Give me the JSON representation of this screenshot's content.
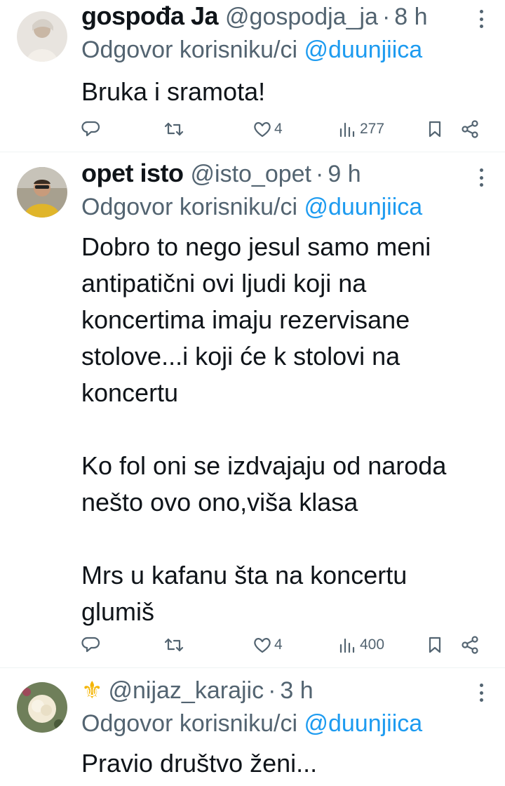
{
  "reply_prefix": "Odgovor korisniku/ci",
  "tweets": [
    {
      "name": "gospođa Ja",
      "handle": "@gospodja_ja",
      "separator": "·",
      "time": "8 h",
      "reply_to": "@duunjiica",
      "text": "Bruka i sramota!",
      "likes": "4",
      "views": "277"
    },
    {
      "name": "opet isto",
      "handle": "@isto_opet",
      "separator": "·",
      "time": "9 h",
      "reply_to": "@duunjiica",
      "text": "Dobro to nego jesul samo meni\nantipatični ovi ljudi koji na\nkoncertima imaju rezervisane\nstolove...i koji će k stolovi na\nkoncertu\n\nKo fol oni se izdvajaju od naroda\nnešto ovo ono,viša klasa\n\nMrs u kafanu šta na koncertu\nglumiš",
      "likes": "4",
      "views": "400"
    },
    {
      "name_emoji": "⚜",
      "handle": "@nijaz_karajic",
      "separator": "·",
      "time": "3 h",
      "reply_to": "@duunjiica",
      "text": "Pravio društvo ženi..."
    }
  ],
  "icons": {
    "reply": "reply-icon",
    "retweet": "retweet-icon",
    "like": "heart-icon",
    "views": "views-icon",
    "bookmark": "bookmark-icon",
    "share": "share-icon",
    "more": "more-icon"
  },
  "colors": {
    "link": "#1d9bf0",
    "secondary": "#536471",
    "text": "#0f1419",
    "divider": "#eff3f4"
  }
}
